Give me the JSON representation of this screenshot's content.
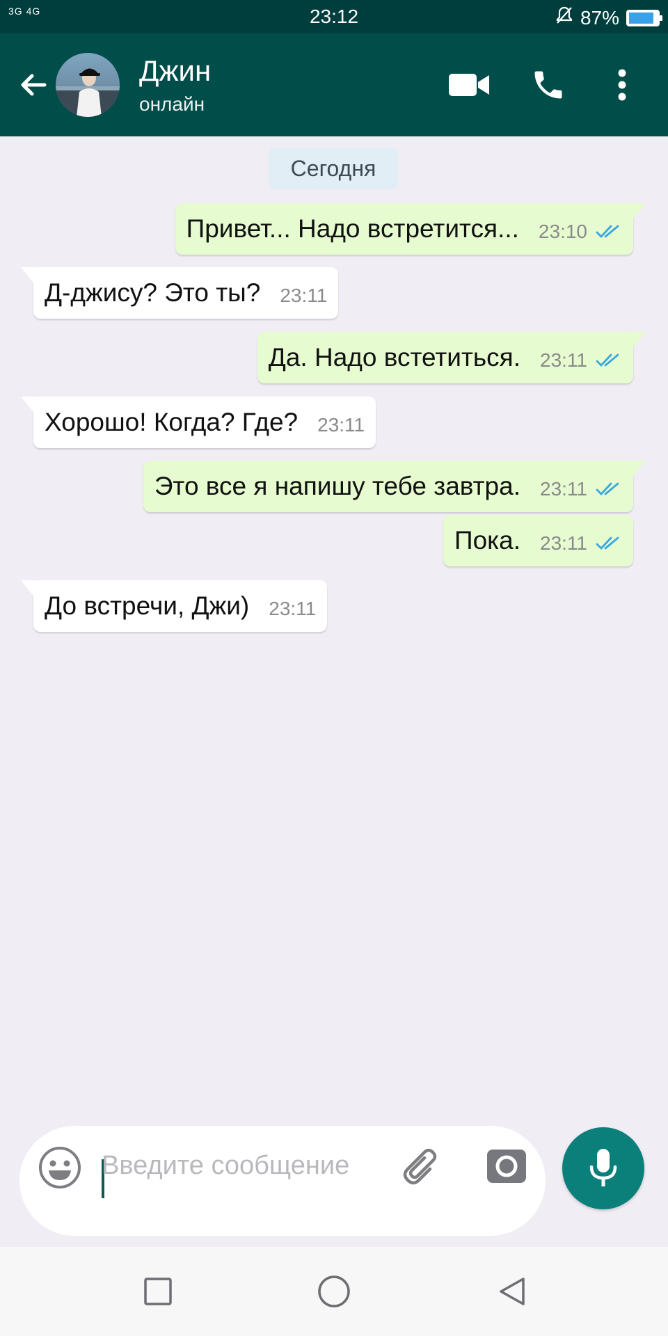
{
  "status_bar": {
    "signal": "3G 4G",
    "time": "23:12",
    "battery": "87%",
    "battery_level": 0.87
  },
  "chat_header": {
    "contact_name": "Джин",
    "status": "онлайн"
  },
  "date_divider": "Сегодня",
  "messages": [
    {
      "direction": "out",
      "text": "Привет... Надо встретится...",
      "time": "23:10",
      "read": true
    },
    {
      "direction": "in",
      "text": "Д-джису? Это ты?",
      "time": "23:11"
    },
    {
      "direction": "out",
      "text": "Да. Надо встетиться.",
      "time": "23:11",
      "read": true
    },
    {
      "direction": "in",
      "text": "Хорошо! Когда? Где?",
      "time": "23:11"
    },
    {
      "direction": "out",
      "text": "Это все я напишу тебе завтра.",
      "time": "23:11",
      "read": true
    },
    {
      "direction": "out",
      "text": "Пока.",
      "time": "23:11",
      "read": true
    },
    {
      "direction": "in",
      "text": "До встречи, Джи)",
      "time": "23:11"
    }
  ],
  "composer": {
    "placeholder": "Введите сообщение"
  },
  "colors": {
    "header": "#004d4a",
    "status_bar": "#003e3e",
    "outgoing_bubble": "#e6fbcf",
    "incoming_bubble": "#ffffff",
    "chat_background": "#f0edf5",
    "read_tick": "#3aa7e0",
    "mic_button": "#0b7f7a"
  },
  "icons": [
    "back-arrow-icon",
    "video-call-icon",
    "phone-icon",
    "more-vert-icon",
    "emoji-icon",
    "attach-icon",
    "camera-icon",
    "mic-icon",
    "nav-square-icon",
    "nav-circle-icon",
    "nav-back-icon"
  ]
}
